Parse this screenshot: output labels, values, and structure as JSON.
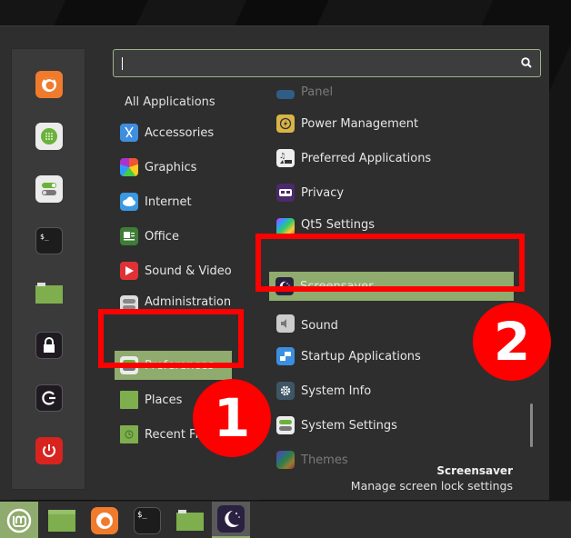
{
  "colors": {
    "accent": "#8fab6e",
    "highlight_box": "#ff0000",
    "menu_bg": "#2e2e2e",
    "favorites_bg": "#3a3a3a",
    "search_border": "#9fb38a"
  },
  "favorites": [
    {
      "name": "firefox",
      "icon": "firefox-icon"
    },
    {
      "name": "software-manager",
      "icon": "software-manager-icon"
    },
    {
      "name": "system-settings",
      "icon": "toggle-settings-icon"
    },
    {
      "name": "terminal",
      "icon": "terminal-icon"
    },
    {
      "name": "files",
      "icon": "folder-icon"
    },
    {
      "name": "lock-screen",
      "icon": "lock-icon"
    },
    {
      "name": "logout",
      "icon": "logout-icon"
    },
    {
      "name": "shutdown",
      "icon": "power-icon"
    }
  ],
  "search": {
    "value": "",
    "placeholder": "",
    "icon": "search-icon"
  },
  "categories": {
    "all_label": "All Applications",
    "items": [
      {
        "label": "Accessories",
        "icon": "scissors-icon"
      },
      {
        "label": "Graphics",
        "icon": "graphics-icon"
      },
      {
        "label": "Internet",
        "icon": "cloud-icon"
      },
      {
        "label": "Office",
        "icon": "office-icon"
      },
      {
        "label": "Sound & Video",
        "icon": "play-icon"
      },
      {
        "label": "Administration",
        "icon": "admin-icon"
      },
      {
        "label": "Preferences",
        "icon": "toggle-settings-icon",
        "selected": true
      },
      {
        "label": "Places",
        "icon": "folder-icon"
      },
      {
        "label": "Recent Files",
        "icon": "recent-folder-icon"
      }
    ]
  },
  "apps": {
    "items": [
      {
        "label": "Panel",
        "icon": "panel-icon",
        "faded": true
      },
      {
        "label": "Power Management",
        "icon": "power-management-icon"
      },
      {
        "label": "Preferred Applications",
        "icon": "preferred-apps-icon"
      },
      {
        "label": "Privacy",
        "icon": "privacy-mask-icon"
      },
      {
        "label": "Qt5 Settings",
        "icon": "qt5-brush-icon"
      },
      {
        "label": "Screensaver",
        "icon": "moon-icon",
        "selected": true
      },
      {
        "label": "Sound",
        "icon": "speaker-icon"
      },
      {
        "label": "Startup Applications",
        "icon": "startup-icon"
      },
      {
        "label": "System Info",
        "icon": "gear-icon"
      },
      {
        "label": "System Settings",
        "icon": "toggle-settings-icon"
      },
      {
        "label": "Themes",
        "icon": "themes-brush-icon",
        "faded": true
      }
    ]
  },
  "annotations": [
    {
      "label": "1",
      "target": "Preferences"
    },
    {
      "label": "2",
      "target": "Screensaver"
    }
  ],
  "description": {
    "title": "Screensaver",
    "text": "Manage screen lock settings"
  },
  "taskbar": [
    {
      "name": "menu",
      "icon": "mint-logo-icon",
      "active": true
    },
    {
      "name": "show-desktop",
      "icon": "desktop-icon"
    },
    {
      "name": "firefox",
      "icon": "firefox-icon"
    },
    {
      "name": "terminal",
      "icon": "terminal-icon"
    },
    {
      "name": "files",
      "icon": "folder-icon"
    },
    {
      "name": "screensaver",
      "icon": "moon-icon",
      "active": true
    }
  ]
}
